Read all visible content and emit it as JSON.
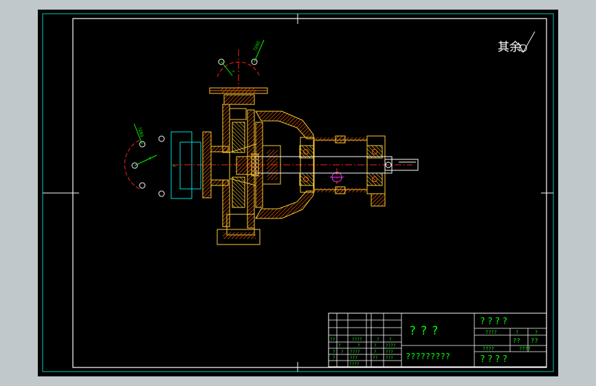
{
  "roughness_note": "其余",
  "title_block": {
    "title_cell": "???",
    "company_cell": "????",
    "bottom_left_cell": "?????????",
    "bottom_right_cell": "????",
    "mid_cells": [
      "????",
      "?",
      "?"
    ],
    "grid_marks": [
      "??",
      "????",
      "?",
      "?",
      "?",
      "?",
      "?",
      "????",
      "????",
      "?",
      "?",
      "?",
      "???",
      "?",
      "???",
      "???",
      "??",
      "????"
    ],
    "right_small": [
      "??",
      "??",
      "????",
      "????"
    ]
  },
  "dimensions": [
    "?200",
    "?280",
    "?",
    "?",
    "?"
  ],
  "colors": {
    "background": "#000000",
    "frame": "#ffffff",
    "outer_border": "#00c8c8",
    "part_outline": "#ffcc33",
    "section_fill": "#ff6600",
    "centerline": "#ff2020",
    "dimension": "#00ff00",
    "flange": "#00e0e0"
  }
}
